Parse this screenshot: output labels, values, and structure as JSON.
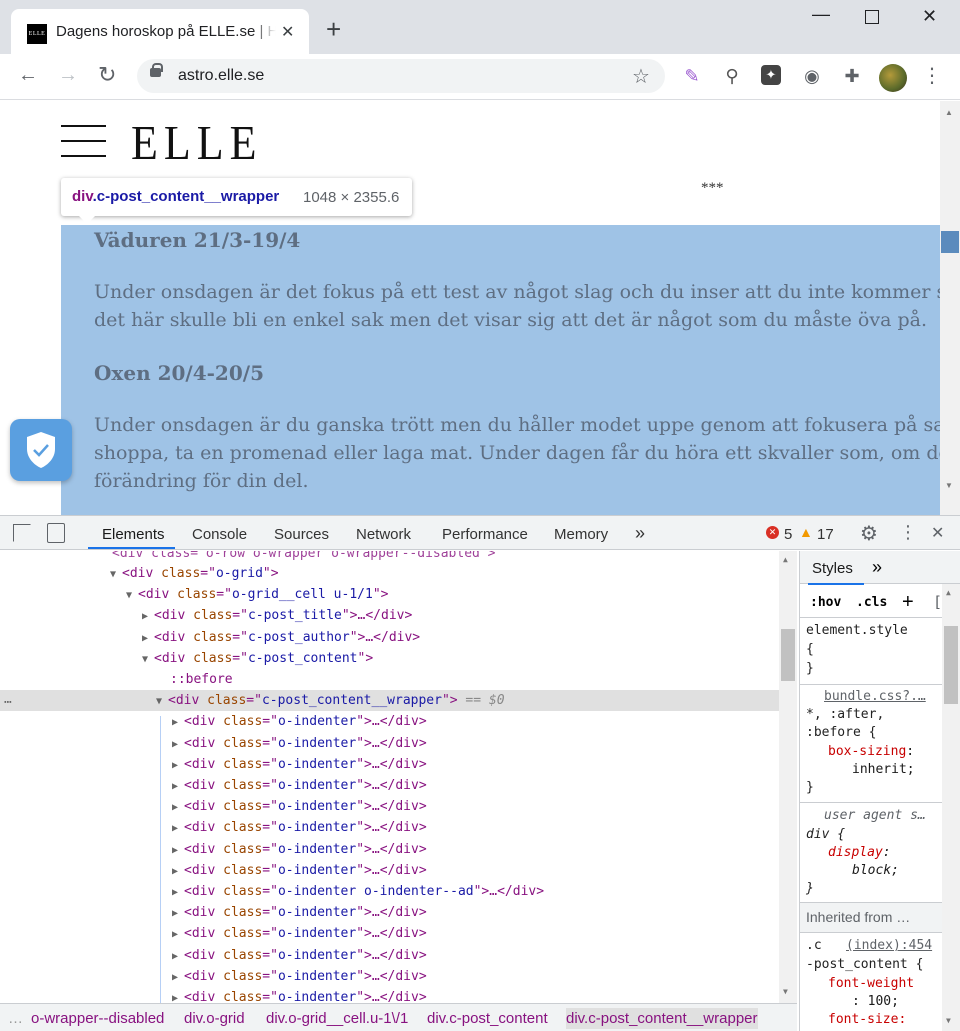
{
  "browser": {
    "tab_title": "Dagens horoskop på ELLE.se | Horoskop",
    "tab_favicon_text": "ELLE",
    "new_tab": "+",
    "url": "astro.elle.se"
  },
  "page": {
    "logo": "ELLE",
    "separator": "***",
    "sections": [
      {
        "heading": "Väduren 21/3-19/4",
        "lines": [
          "Under onsdagen är det fokus på ett test av något slag och du inser att du inte kommer så långt som du trott. Du trodde",
          "det här skulle bli en enkel sak men det visar sig att det är något som du måste öva på."
        ]
      },
      {
        "heading": "Oxen 20/4-20/5",
        "lines": [
          "Under onsdagen är du ganska trött men du håller modet uppe genom att fokusera på saker som gör dig glad, som att",
          "shoppa, ta en promenad eller laga mat. Under dagen får du höra ett skvaller som, om det stämmer, kan innebära en",
          "förändring för din del."
        ]
      }
    ]
  },
  "inspect_tooltip": {
    "tag": "div",
    "class": ".c-post_content__wrapper",
    "size": "1048 × 2355.6"
  },
  "devtools": {
    "tabs": [
      "Elements",
      "Console",
      "Sources",
      "Network",
      "Performance",
      "Memory"
    ],
    "more": "»",
    "errors": "5",
    "warnings": "17",
    "dom_top_partial": "<div class=\"o-row o-wrapper o-wrapper--disabled\">",
    "dom_rows": [
      {
        "indent": 110,
        "tri": "▼",
        "tag": "div",
        "cls": "o-grid",
        "tail": ">"
      },
      {
        "indent": 126,
        "tri": "▼",
        "tag": "div",
        "cls": "o-grid__cell u-1/1",
        "tail": ">"
      },
      {
        "indent": 142,
        "tri": "▶",
        "tag": "div",
        "cls": "c-post_title",
        "tail": ">…</div>"
      },
      {
        "indent": 142,
        "tri": "▶",
        "tag": "div",
        "cls": "c-post_author",
        "tail": ">…</div>"
      },
      {
        "indent": 142,
        "tri": "▼",
        "tag": "div",
        "cls": "c-post_content",
        "tail": ">"
      },
      {
        "indent": 170,
        "pseudo": "::before"
      },
      {
        "indent": 156,
        "tri": "▼",
        "tag": "div",
        "cls": "c-post_content__wrapper",
        "tail": ">",
        "sel": true,
        "eq": " == $0"
      },
      {
        "indent": 172,
        "tri": "▶",
        "tag": "div",
        "cls": "o-indenter",
        "tail": ">…</div>"
      },
      {
        "indent": 172,
        "tri": "▶",
        "tag": "div",
        "cls": "o-indenter",
        "tail": ">…</div>"
      },
      {
        "indent": 172,
        "tri": "▶",
        "tag": "div",
        "cls": "o-indenter",
        "tail": ">…</div>"
      },
      {
        "indent": 172,
        "tri": "▶",
        "tag": "div",
        "cls": "o-indenter",
        "tail": ">…</div>"
      },
      {
        "indent": 172,
        "tri": "▶",
        "tag": "div",
        "cls": "o-indenter",
        "tail": ">…</div>"
      },
      {
        "indent": 172,
        "tri": "▶",
        "tag": "div",
        "cls": "o-indenter",
        "tail": ">…</div>"
      },
      {
        "indent": 172,
        "tri": "▶",
        "tag": "div",
        "cls": "o-indenter",
        "tail": ">…</div>"
      },
      {
        "indent": 172,
        "tri": "▶",
        "tag": "div",
        "cls": "o-indenter",
        "tail": ">…</div>"
      },
      {
        "indent": 172,
        "tri": "▶",
        "tag": "div",
        "cls": "o-indenter o-indenter--ad",
        "tail": ">…</div>"
      },
      {
        "indent": 172,
        "tri": "▶",
        "tag": "div",
        "cls": "o-indenter",
        "tail": ">…</div>"
      },
      {
        "indent": 172,
        "tri": "▶",
        "tag": "div",
        "cls": "o-indenter",
        "tail": ">…</div>"
      },
      {
        "indent": 172,
        "tri": "▶",
        "tag": "div",
        "cls": "o-indenter",
        "tail": ">…</div>"
      },
      {
        "indent": 172,
        "tri": "▶",
        "tag": "div",
        "cls": "o-indenter",
        "tail": ">…</div>"
      },
      {
        "indent": 172,
        "tri": "▶",
        "tag": "div",
        "cls": "o-indenter",
        "tail": ">…</div>"
      }
    ],
    "breadcrumb": [
      "…",
      "o-wrapper--disabled",
      "div.o-grid",
      "div.o-grid__cell.u-1\\/1",
      "div.c-post_content",
      "div.c-post_content__wrapper"
    ],
    "styles": {
      "tab": "Styles",
      "more": "»",
      "hov": ":hov",
      "cls": ".cls",
      "plus": "+",
      "element_style": "element.style",
      "open_brace": "{",
      "close_brace": "}",
      "rule1_source": "bundle.css?.…",
      "rule1_sel_a": "*, :after,",
      "rule1_sel_b": ":before {",
      "rule1_prop": "box-sizing",
      "rule1_val": "inherit;",
      "rule2_source": "user agent s…",
      "rule2_sel": "div {",
      "rule2_prop": "display",
      "rule2_val": "block;",
      "inherited": "Inherited from …",
      "rule3_sel_a": ".c",
      "rule3_source": "(index):454",
      "rule3_sel_b": "-post_content {",
      "rule3_prop1": "font-weight",
      "rule3_val1": ": 100;",
      "rule3_prop2": "font-size:"
    }
  }
}
